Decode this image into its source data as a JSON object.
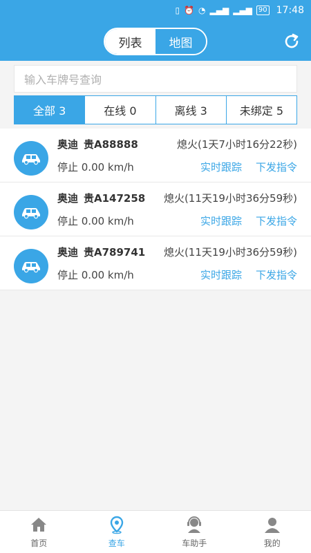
{
  "status_bar": {
    "battery": "90",
    "time": "17:48"
  },
  "header": {
    "tabs": [
      {
        "label": "列表",
        "active": true
      },
      {
        "label": "地图",
        "active": false
      }
    ]
  },
  "search": {
    "placeholder": "输入车牌号查询"
  },
  "filters": [
    {
      "label": "全部 3",
      "active": true
    },
    {
      "label": "在线 0",
      "active": false
    },
    {
      "label": "离线 3",
      "active": false
    },
    {
      "label": "未绑定 5",
      "active": false
    }
  ],
  "vehicles": [
    {
      "brand": "奥迪",
      "plate": "贵A88888",
      "status": "熄火(1天7小时16分22秒)",
      "speed": "停止  0.00 km/h",
      "track_label": "实时跟踪",
      "command_label": "下发指令"
    },
    {
      "brand": "奥迪",
      "plate": "贵A147258",
      "status": "熄火(11天19小时36分59秒)",
      "speed": "停止  0.00 km/h",
      "track_label": "实时跟踪",
      "command_label": "下发指令"
    },
    {
      "brand": "奥迪",
      "plate": "贵A789741",
      "status": "熄火(11天19小时36分59秒)",
      "speed": "停止  0.00 km/h",
      "track_label": "实时跟踪",
      "command_label": "下发指令"
    }
  ],
  "tabbar": [
    {
      "label": "首页",
      "icon": "home-icon",
      "active": false
    },
    {
      "label": "查车",
      "icon": "location-pin-icon",
      "active": true
    },
    {
      "label": "车助手",
      "icon": "assistant-icon",
      "active": false
    },
    {
      "label": "我的",
      "icon": "user-icon",
      "active": false
    }
  ],
  "colors": {
    "primary": "#3aa6e6",
    "background": "#f4f4f4"
  }
}
